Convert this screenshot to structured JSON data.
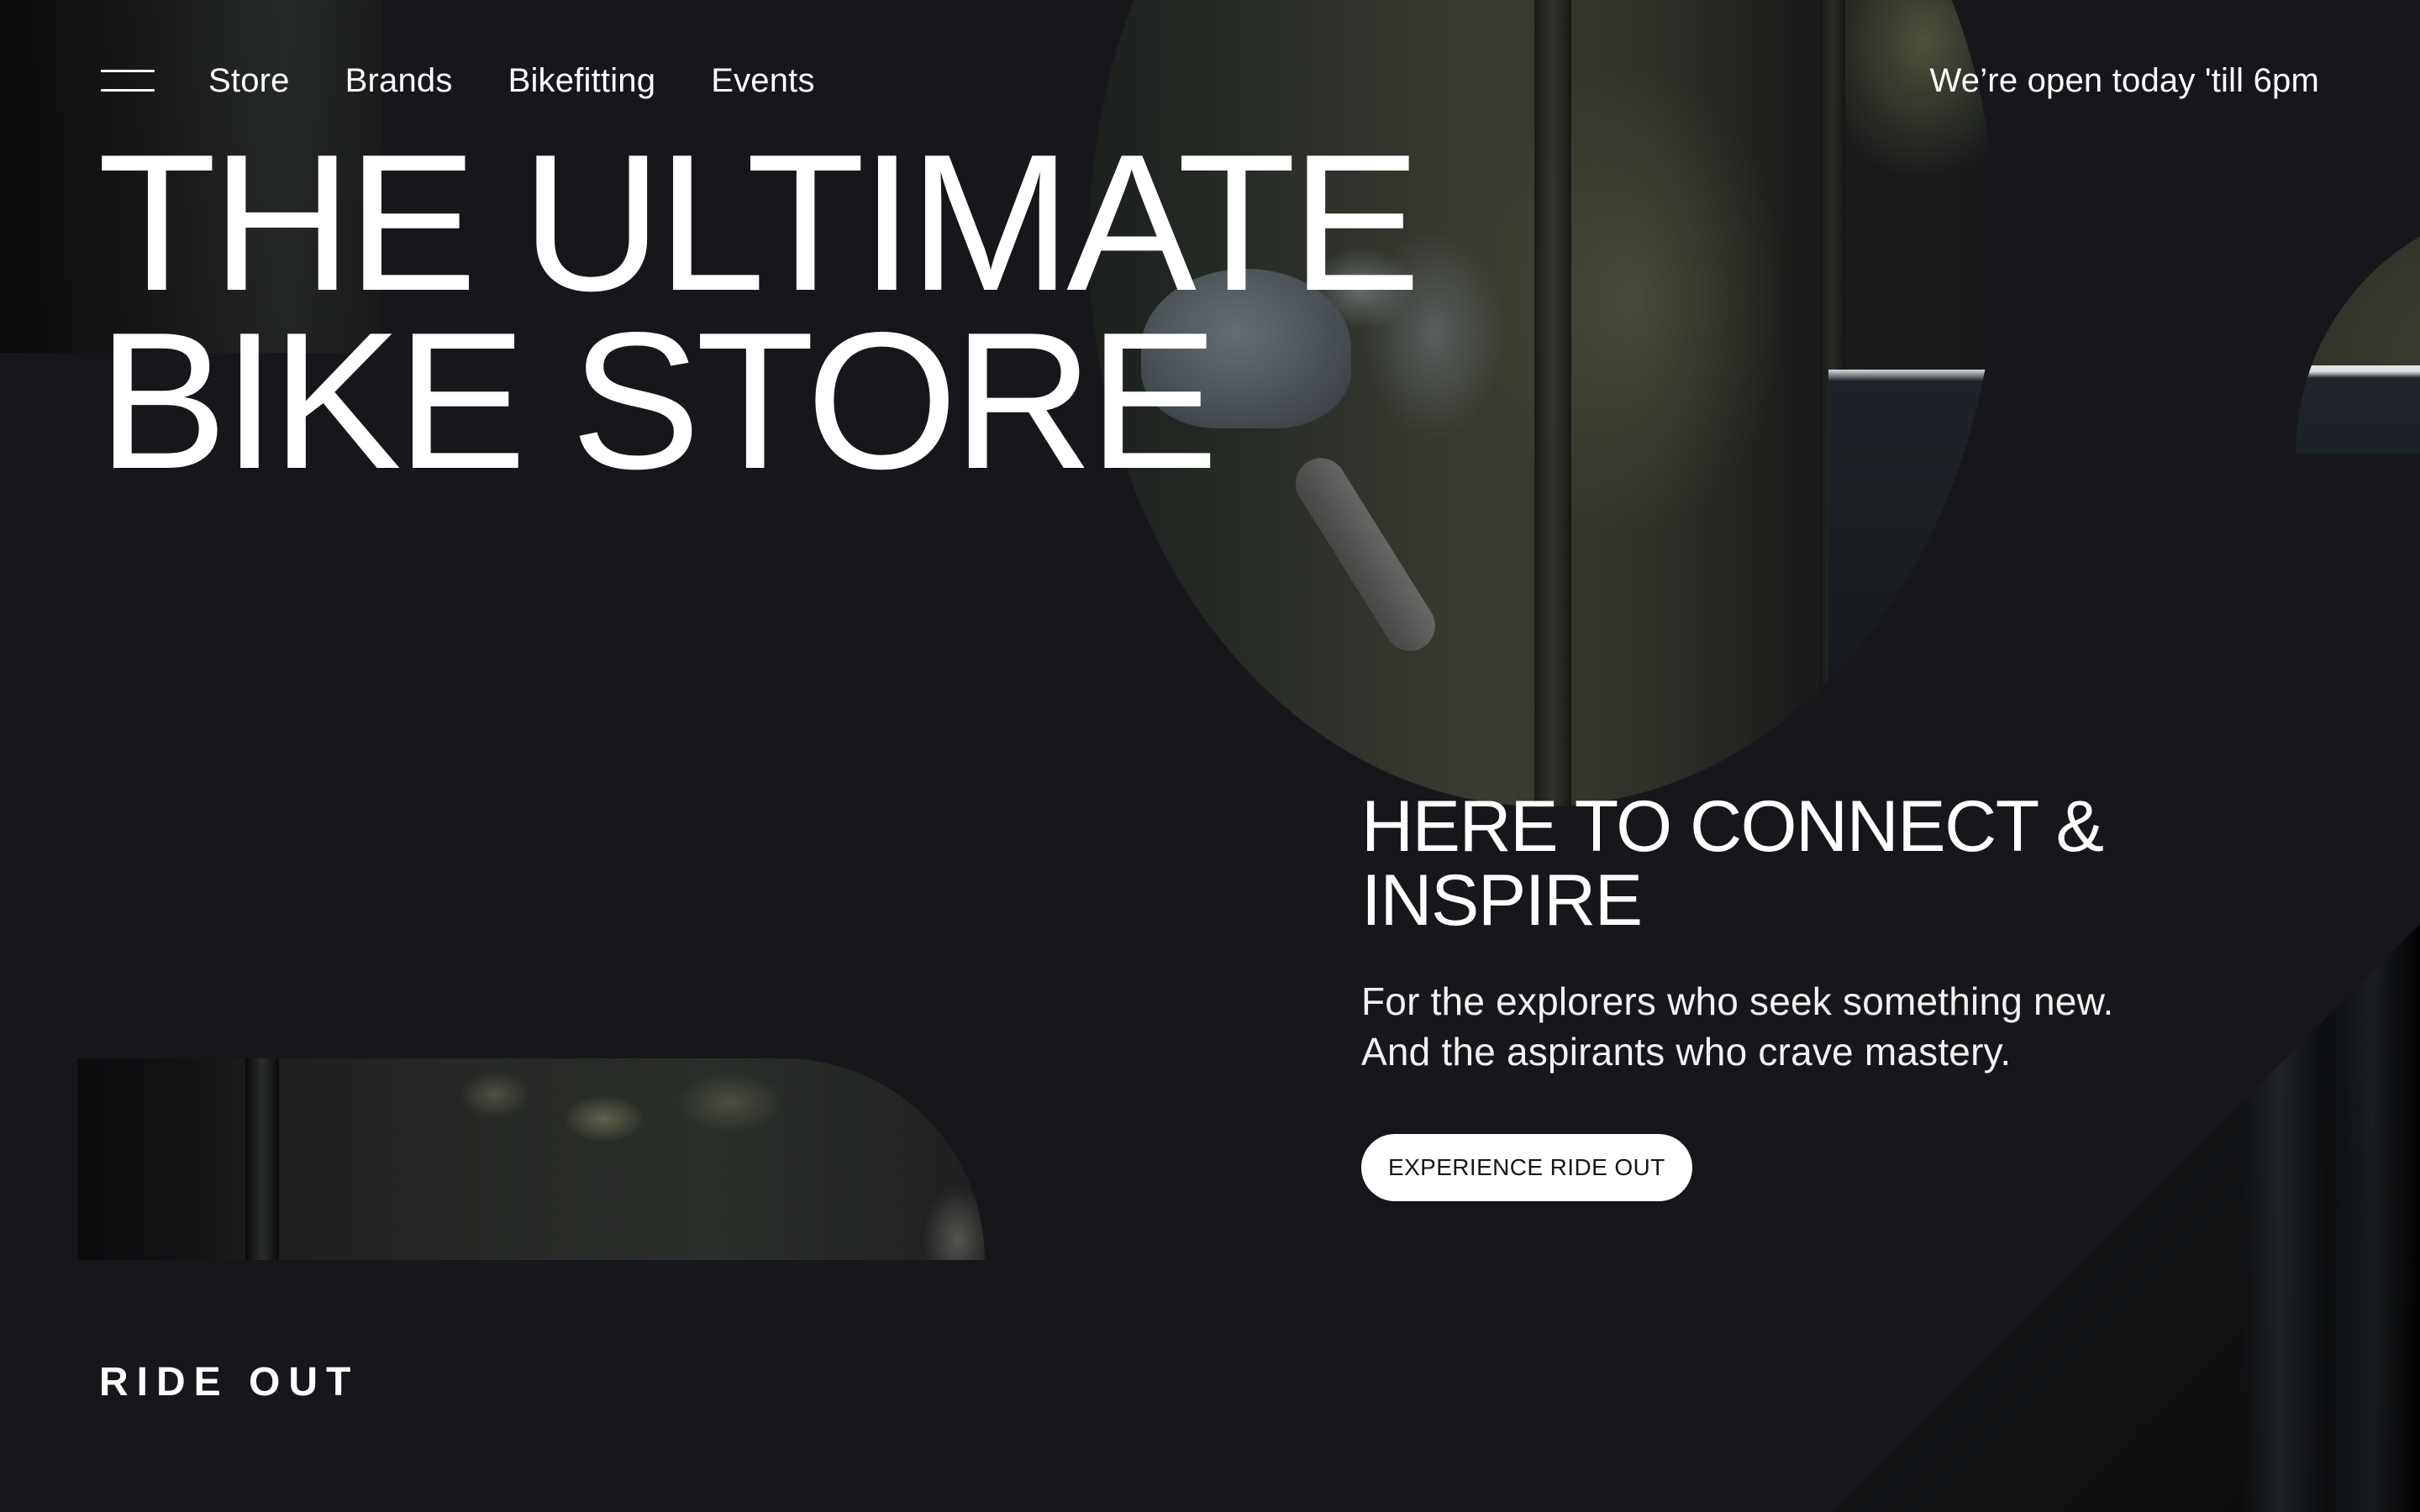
{
  "nav": {
    "menu_icon": "hamburger-menu-icon",
    "links": [
      "Store",
      "Brands",
      "Bikefitting",
      "Events"
    ],
    "open_hours": "We’re open today 'till 6pm"
  },
  "hero": {
    "title_line_1": "THE ULTIMATE",
    "title_line_2": "BIKE STORE"
  },
  "intro": {
    "heading": "HERE TO CONNECT & INSPIRE",
    "body_line_1": "For the explorers who seek something new.",
    "body_line_2": "And the aspirants who crave mastery.",
    "cta_label": "EXPERIENCE RIDE OUT"
  },
  "footer": {
    "brand_label": "RIDE OUT"
  },
  "colors": {
    "background": "#17171b",
    "text": "#ffffff",
    "button_bg": "#ffffff",
    "button_text": "#17171b"
  }
}
